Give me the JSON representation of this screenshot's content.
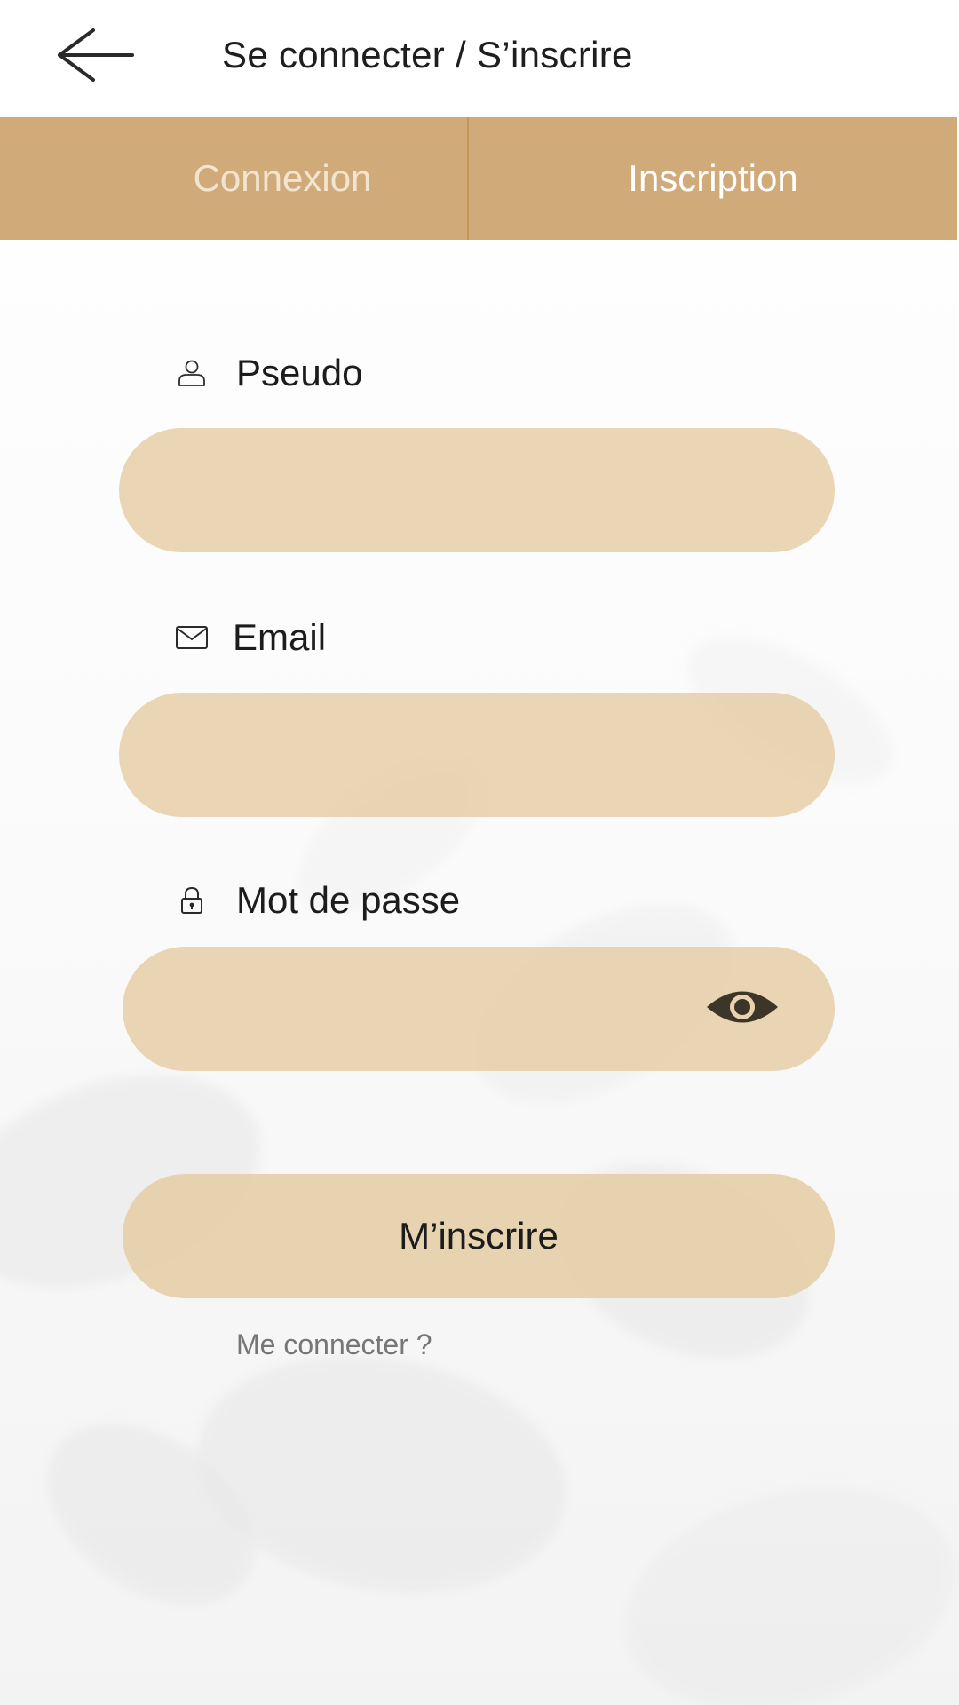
{
  "header": {
    "title": "Se connecter / S’inscrire",
    "back_icon": "arrow-left-icon"
  },
  "tabs": [
    {
      "label": "Connexion",
      "active": false
    },
    {
      "label": "Inscription",
      "active": true
    }
  ],
  "form": {
    "pseudo": {
      "label": "Pseudo",
      "icon": "user-icon",
      "value": ""
    },
    "email": {
      "label": "Email",
      "icon": "mail-icon",
      "value": ""
    },
    "password": {
      "label": "Mot de passe",
      "icon": "lock-icon",
      "value": "",
      "toggle_icon": "eye-icon"
    },
    "submit_label": "M’inscrire",
    "switch_link": "Me connecter ?"
  },
  "colors": {
    "accent": "#d0ab79",
    "field_background": "#e8d3b1",
    "tab_inactive_text": "#f1e4d1",
    "tab_active_text": "#ffffff",
    "link_text": "#767676"
  }
}
